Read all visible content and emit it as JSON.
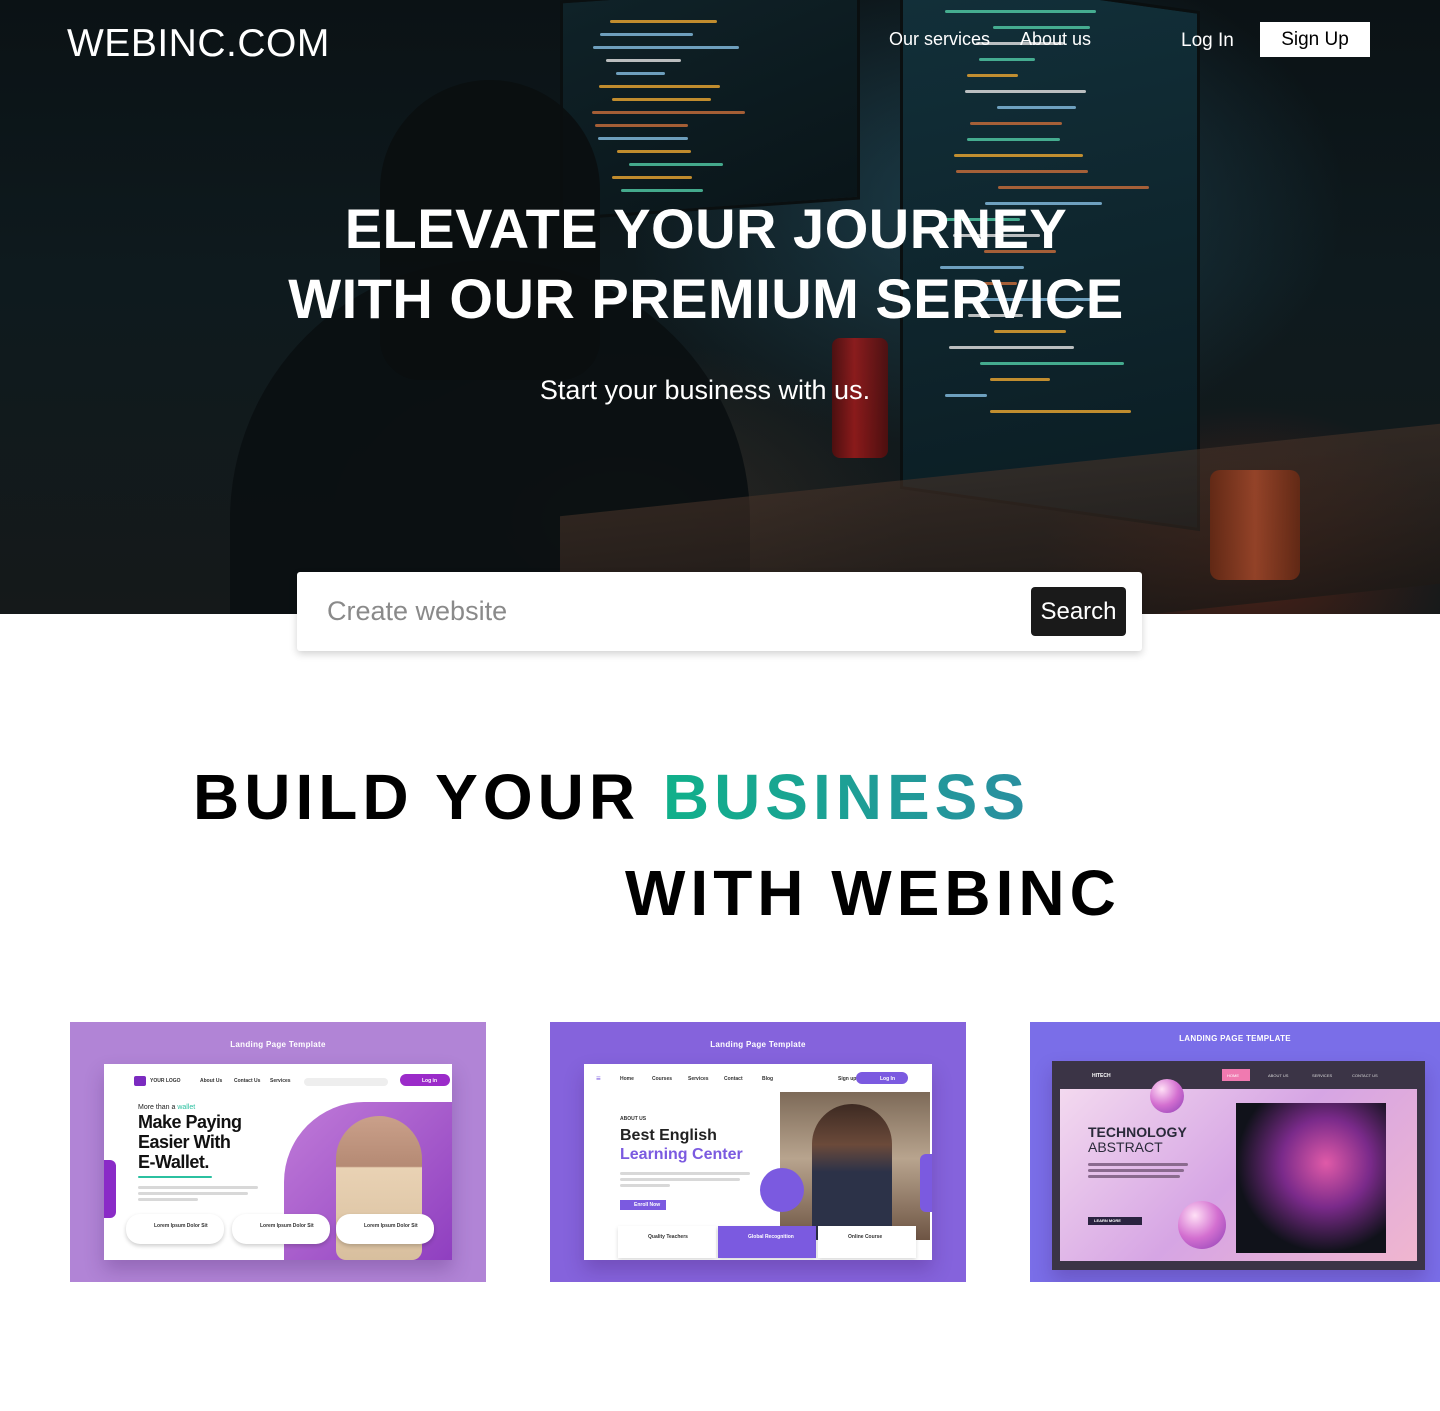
{
  "brand": {
    "logo": "WEBINC.COM"
  },
  "nav": {
    "links": [
      "Our services",
      "About us"
    ],
    "login": "Log In",
    "signup": "Sign Up"
  },
  "hero": {
    "title_line1": "ELEVATE YOUR JOURNEY",
    "title_line2": "WITH OUR PREMIUM SERVICE",
    "subtitle": "Start your business with us."
  },
  "search": {
    "placeholder": "Create website",
    "value": "",
    "button": "Search"
  },
  "build": {
    "line1_prefix": "BUILD YOUR",
    "line1_accent": "BUSINESS",
    "line2": "WITH WEBINC",
    "accent_colors": [
      "#10b08a",
      "#2a8fa0"
    ]
  },
  "templates": [
    {
      "label": "Landing Page Template",
      "preview": {
        "nav": [
          "About Us",
          "Contact Us",
          "Services"
        ],
        "logo": "YOUR LOGO",
        "button": "Log in",
        "pre": "More than a",
        "pre_accent": "wallet",
        "heading": [
          "Make Paying",
          "Easier With",
          "E-Wallet."
        ],
        "chips": [
          "Lorem Ipsum Dolor Sit",
          "Lorem Ipsum Dolor Sit",
          "Lorem Ipsum Dolor Sit"
        ]
      }
    },
    {
      "label": "Landing Page Template",
      "preview": {
        "nav": [
          "Home",
          "Courses",
          "Services",
          "Contact",
          "Blog"
        ],
        "signup": "Sign up",
        "login": "Log In",
        "eyebrow": "ABOUT US",
        "heading": "Best English",
        "heading_accent": "Learning Center",
        "button": "Enroll Now",
        "features": [
          "Quality Teachers",
          "Global Recognition",
          "Online Course"
        ]
      }
    },
    {
      "label": "LANDING PAGE TEMPLATE",
      "preview": {
        "logo": "HITECH",
        "nav": [
          "HOME",
          "ABOUT US",
          "SERVICES",
          "CONTACT US"
        ],
        "heading": "TECHNOLOGY",
        "heading_light": "ABSTRACT",
        "button": "LEARN MORE"
      }
    }
  ]
}
